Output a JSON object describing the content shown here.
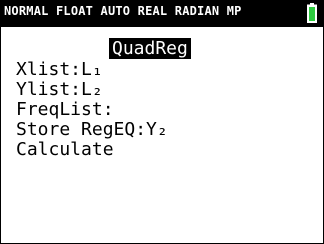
{
  "status_bar": {
    "text": "NORMAL FLOAT AUTO REAL RADIAN MP",
    "battery_icon": "battery-icon",
    "battery_color": "#2ecc40"
  },
  "screen": {
    "title": "QuadReg",
    "items": [
      "Xlist:L₁",
      "Ylist:L₂",
      "FreqList:",
      "Store RegEQ:Y₂",
      "Calculate"
    ]
  }
}
